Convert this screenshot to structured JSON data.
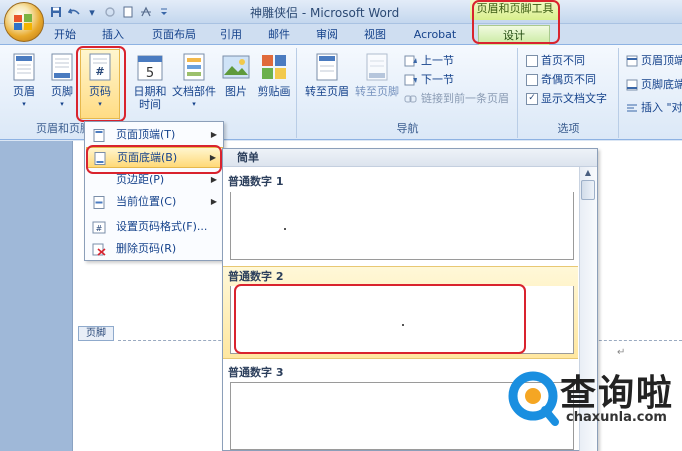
{
  "app": {
    "title": "神雕侠侣 - Microsoft Word",
    "context_tool": "页眉和页脚工具"
  },
  "quick_access": {
    "items": [
      "save-icon",
      "undo-icon",
      "redo-icon",
      "new-icon",
      "paint-icon"
    ],
    "more": "▾"
  },
  "tabs": [
    "开始",
    "插入",
    "页面布局",
    "引用",
    "邮件",
    "审阅",
    "视图",
    "Acrobat",
    "设计"
  ],
  "ribbon": {
    "group1": {
      "label": "页眉和页脚",
      "header_btn": "页眉",
      "footer_btn": "页脚",
      "page_number_btn": "页码",
      "page_number_icon": "#"
    },
    "group_insert": {
      "date_time_btn": "日期和\n时间",
      "date_icon_num": "5",
      "doc_parts_btn": "文档部件",
      "picture_btn": "图片",
      "clipart_btn": "剪贴画"
    },
    "group_nav": {
      "label": "导航",
      "goto_header": "转至页眉",
      "goto_footer": "转至页脚",
      "prev_section": "上一节",
      "next_section": "下一节",
      "link_prev": "链接到前一条页眉"
    },
    "group_options": {
      "label": "选项",
      "first_page": "首页不同",
      "odd_even": "奇偶页不同",
      "show_doc_text": "显示文档文字",
      "show_doc_text_checked": "✓"
    },
    "group_position": {
      "header_top": "页眉顶端",
      "footer_bottom": "页脚底端",
      "insert_align": "插入 \"对"
    }
  },
  "menu": {
    "items": [
      {
        "label": "页面顶端(T)",
        "has_sub": true
      },
      {
        "label": "页面底端(B)",
        "has_sub": true
      },
      {
        "label": "页边距(P)",
        "has_sub": true
      },
      {
        "label": "当前位置(C)",
        "has_sub": true
      },
      {
        "label": "设置页码格式(F)...",
        "has_sub": false
      },
      {
        "label": "删除页码(R)",
        "has_sub": false
      }
    ],
    "submenu_arrow": "▶"
  },
  "gallery": {
    "header": "简单",
    "items": [
      {
        "caption": "普通数字 1"
      },
      {
        "caption": "普通数字 2"
      },
      {
        "caption": "普通数字 3"
      }
    ],
    "scroll_up": "▲"
  },
  "document": {
    "footer_label": "页脚",
    "para_mark": "↵"
  },
  "watermark": {
    "text": "查询啦",
    "url": "chaxunla.com"
  },
  "colors": {
    "accent": "#15428b",
    "highlight": "#ffd978",
    "annotation": "#d9232e",
    "design_tab": "#c7e99b"
  }
}
